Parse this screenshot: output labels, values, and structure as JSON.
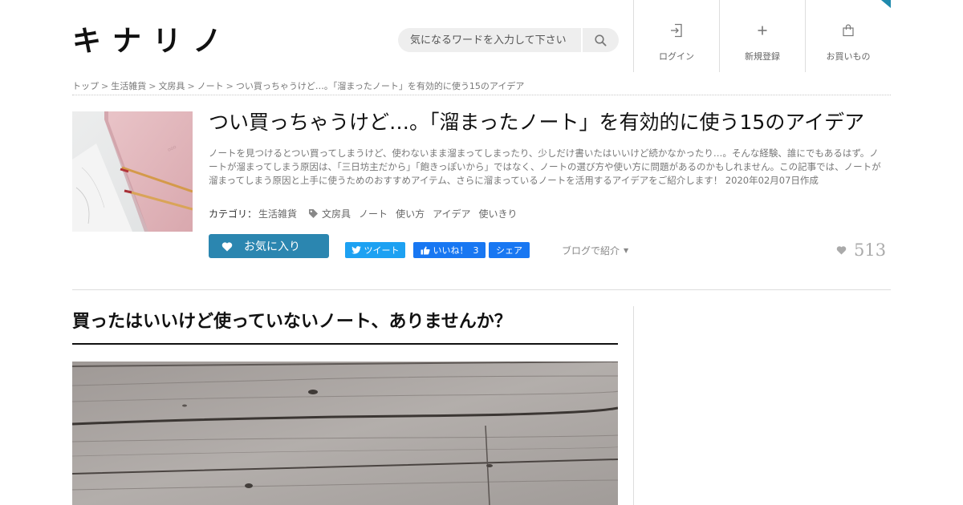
{
  "site": {
    "logo": "キナリノ"
  },
  "search": {
    "placeholder": "気になるワードを入力して下さい",
    "value": ""
  },
  "nav": {
    "login": "ログイン",
    "signup": "新規登録",
    "shopping": "お買いもの"
  },
  "breadcrumb": {
    "items": [
      "トップ",
      "生活雑貨",
      "文房具",
      "ノート",
      "つい買っちゃうけど…。「溜まったノート」を有効的に使う15のアイデア"
    ],
    "separator": ">"
  },
  "article": {
    "title": "つい買っちゃうけど…。「溜まったノート」を有効的に使う15のアイデア",
    "description": "ノートを見つけるとつい買ってしまうけど、使わないまま溜まってしまったり、少しだけ書いたはいいけど続かなかったり…。そんな経験、誰にでもあるはず。ノートが溜まってしまう原因は、「三日坊主だから」「飽きっぽいから」ではなく、ノートの選び方や使い方に問題があるのかもしれません。この記事では、ノートが溜まってしまう原因と上手に使うためのおすすめアイテム、さらに溜まっているノートを活用するアイデアをご紹介します！",
    "date": "2020年02月07日作成",
    "category_label": "カテゴリ：",
    "category": "生活雑貨",
    "tags": [
      "文房具",
      "ノート",
      "使い方",
      "アイデア",
      "使いきり"
    ],
    "favorite_label": "お気に入り",
    "favorite_count": "513"
  },
  "social": {
    "tweet": "ツイート",
    "like": "いいね！",
    "like_count": "3",
    "share": "シェア",
    "blog_intro": "ブログで紹介",
    "blog_caret": "▼"
  },
  "content": {
    "heading": "買ったはいいけど使っていないノート、ありませんか？"
  },
  "colors": {
    "accent": "#2b86b0",
    "twitter": "#1da1f2",
    "facebook": "#1877f2",
    "corner": "#1f8aad"
  }
}
